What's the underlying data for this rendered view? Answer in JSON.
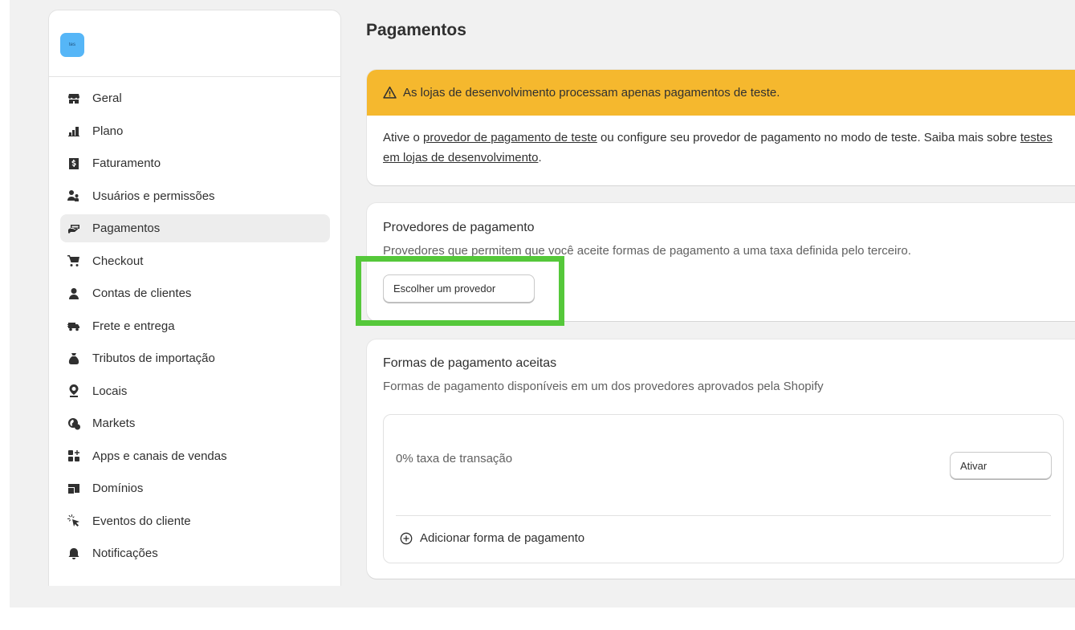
{
  "store": {
    "logo_text": "tes"
  },
  "sidebar": {
    "items": [
      {
        "label": "Geral",
        "icon": "store-icon"
      },
      {
        "label": "Plano",
        "icon": "plan-icon"
      },
      {
        "label": "Faturamento",
        "icon": "billing-icon"
      },
      {
        "label": "Usuários e permissões",
        "icon": "users-icon"
      },
      {
        "label": "Pagamentos",
        "icon": "payments-icon",
        "active": true
      },
      {
        "label": "Checkout",
        "icon": "cart-icon"
      },
      {
        "label": "Contas de clientes",
        "icon": "person-icon"
      },
      {
        "label": "Frete e entrega",
        "icon": "truck-icon"
      },
      {
        "label": "Tributos de importação",
        "icon": "money-bag-icon"
      },
      {
        "label": "Locais",
        "icon": "location-icon"
      },
      {
        "label": "Markets",
        "icon": "globe-icon"
      },
      {
        "label": "Apps e canais de vendas",
        "icon": "apps-icon"
      },
      {
        "label": "Domínios",
        "icon": "domain-icon"
      },
      {
        "label": "Eventos do cliente",
        "icon": "cursor-click-icon"
      },
      {
        "label": "Notificações",
        "icon": "bell-icon"
      }
    ]
  },
  "main": {
    "title": "Pagamentos",
    "banner": {
      "warning": "As lojas de desenvolvimento processam apenas pagamentos de teste.",
      "text_1": "Ative o ",
      "link_1": "provedor de pagamento de teste",
      "text_2": " ou configure seu provedor de pagamento no modo de teste. Saiba mais sobre ",
      "link_2": "testes em lojas de desenvolvimento",
      "text_3": "."
    },
    "providers": {
      "title": "Provedores de pagamento",
      "subtitle": "Provedores que permitem que você aceite formas de pagamento a uma taxa definida pelo terceiro.",
      "button": "Escolher um provedor"
    },
    "methods": {
      "title": "Formas de pagamento aceitas",
      "subtitle": "Formas de pagamento disponíveis em um dos provedores aprovados pela Shopify",
      "fee_label": "0% taxa de transação",
      "activate_button": "Ativar",
      "add_method": "Adicionar forma de pagamento"
    }
  },
  "colors": {
    "warning": "#f5b82e",
    "highlight": "#55c83a",
    "logo": "#56b6f7"
  }
}
